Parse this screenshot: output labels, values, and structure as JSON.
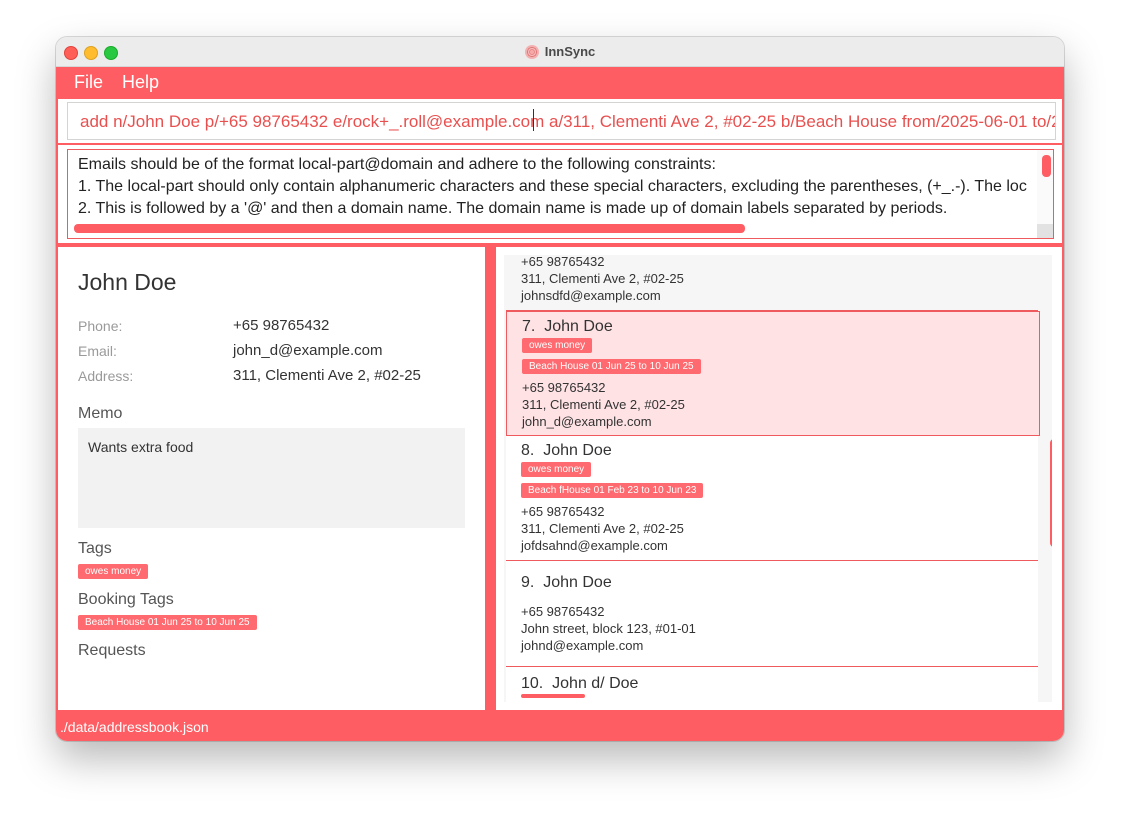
{
  "window": {
    "title": "InnSync"
  },
  "menu": {
    "file": "File",
    "help": "Help"
  },
  "command": {
    "value": "add n/John Doe p/+65 98765432 e/rock+_.roll@example.com a/311, Clementi Ave 2, #02-25 b/Beach House from/2025-06-01 to/2"
  },
  "result": {
    "lines": [
      "Emails should be of the format local-part@domain and adhere to the following constraints:",
      "1. The local-part should only contain alphanumeric characters and these special characters, excluding the parentheses, (+_.-). The loc",
      "2. This is followed by a '@' and then a domain name. The domain name is made up of domain labels separated by periods."
    ]
  },
  "detail": {
    "name": "John Doe",
    "phone_label": "Phone:",
    "phone": "+65 98765432",
    "email_label": "Email:",
    "email": "john_d@example.com",
    "address_label": "Address:",
    "address": "311, Clementi Ave 2, #02-25",
    "memo_label": "Memo",
    "memo": "Wants extra food",
    "tags_label": "Tags",
    "tags": [
      "owes money"
    ],
    "booking_label": "Booking Tags",
    "bookings": [
      "Beach House 01 Jun 25 to 10 Jun 25"
    ],
    "requests_label": "Requests"
  },
  "list": {
    "partial_top": {
      "phone": "+65 98765432",
      "address": "311, Clementi Ave 2, #02-25",
      "email": "johnsdfd@example.com"
    },
    "cards": [
      {
        "index": "7.",
        "name": "John Doe",
        "tags": [
          "owes money"
        ],
        "bookings": [
          "Beach House 01 Jun 25 to 10 Jun 25"
        ],
        "phone": "+65 98765432",
        "address": "311, Clementi Ave 2, #02-25",
        "email": "john_d@example.com"
      },
      {
        "index": "8.",
        "name": "John Doe",
        "tags": [
          "owes money"
        ],
        "bookings": [
          "Beach fHouse 01 Feb 23 to 10 Jun 23"
        ],
        "phone": "+65 98765432",
        "address": "311, Clementi Ave 2, #02-25",
        "email": "jofdsahnd@example.com"
      },
      {
        "index": "9.",
        "name": "John Doe",
        "phone": "+65 98765432",
        "address": "John street, block 123, #01-01",
        "email": "johnd@example.com"
      },
      {
        "index": "10.",
        "name": "John d/ Doe"
      }
    ]
  },
  "status": {
    "path": "./data/addressbook.json"
  },
  "colors": {
    "accent": "#fe5e63",
    "selected_bg": "#ffe2e4",
    "tag_bg": "#fe6a6f"
  }
}
